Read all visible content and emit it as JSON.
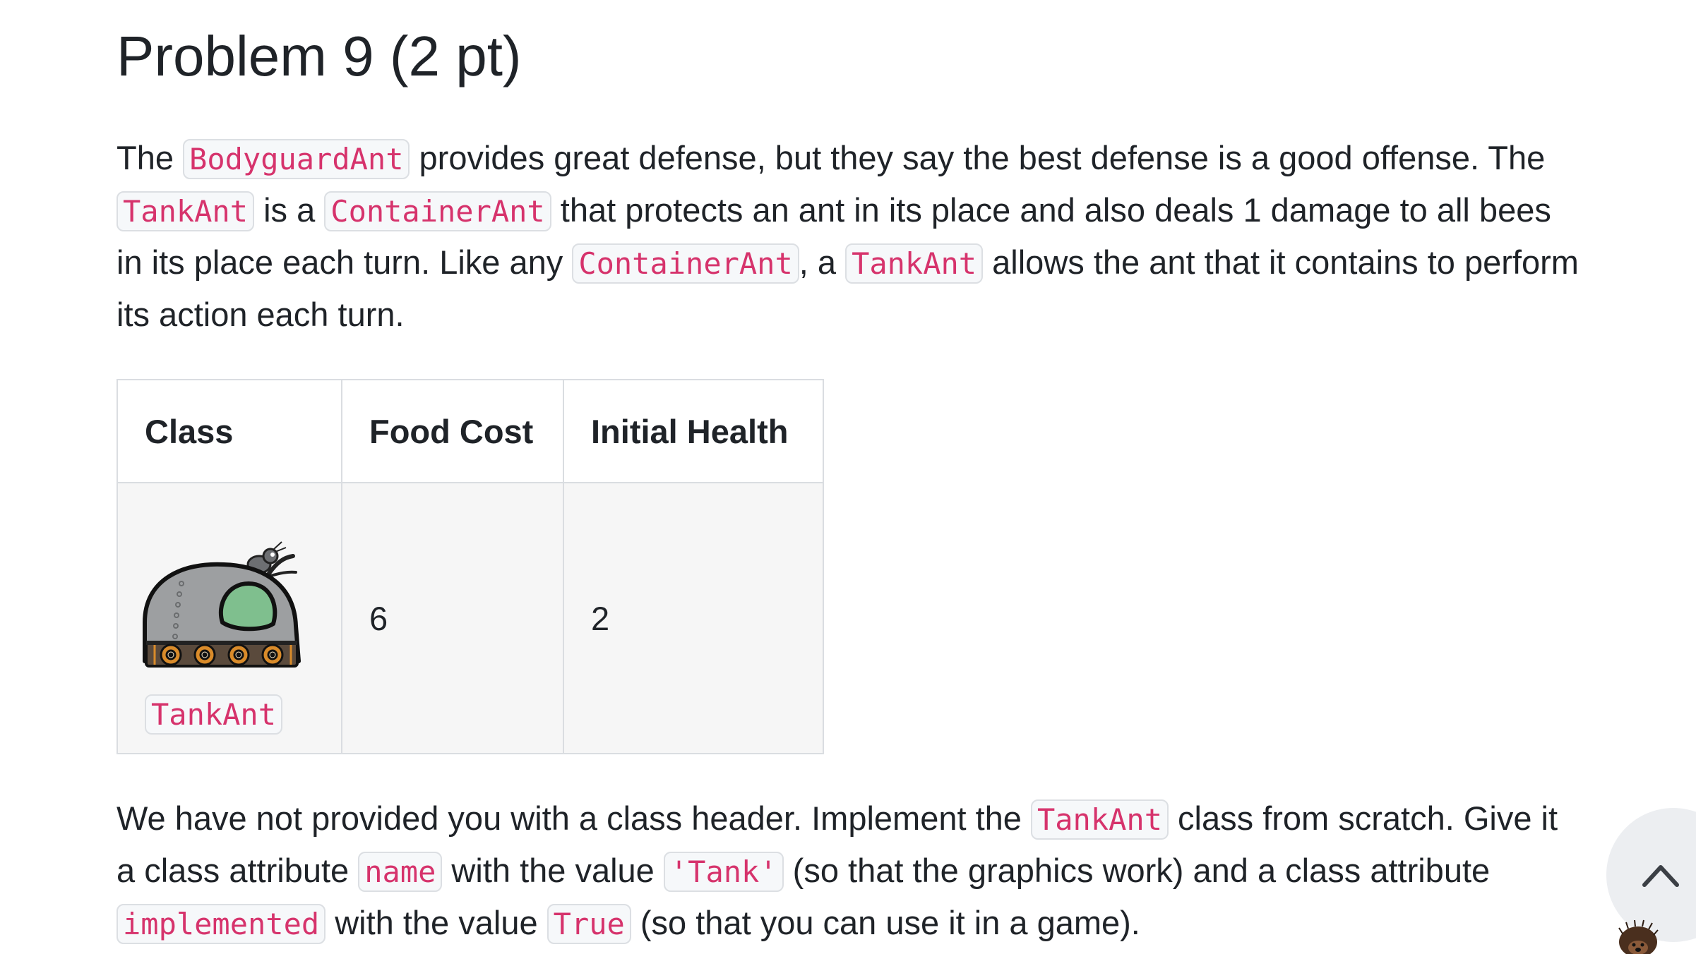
{
  "title": "Problem 9 (2 pt)",
  "paragraph1": {
    "t1": "The ",
    "c1": "BodyguardAnt",
    "t2": " provides great defense, but they say the best defense is a good offense. The ",
    "c2": "TankAnt",
    "t3": " is a ",
    "c3": "ContainerAnt",
    "t4": " that protects an ant in its place and also deals 1 damage to all bees in its place each turn. Like any ",
    "c4": "ContainerAnt",
    "t5": ", a ",
    "c5": "TankAnt",
    "t6": " allows the ant that it contains to perform its action each turn."
  },
  "table": {
    "headers": [
      "Class",
      "Food Cost",
      "Initial Health"
    ],
    "row": {
      "class_name": "TankAnt",
      "food_cost": "6",
      "initial_health": "2"
    }
  },
  "paragraph2": {
    "t1": "We have not provided you with a class header. Implement the ",
    "c1": "TankAnt",
    "t2": " class from scratch. Give it a class attribute ",
    "c2": "name",
    "t3": " with the value ",
    "c3": "'Tank'",
    "t4": " (so that the graphics work) and a class attribute ",
    "c4": "implemented",
    "t5": " with the value ",
    "c5": "True",
    "t6": " (so that you can use it in a game)."
  },
  "icons": {
    "scroll_top": "chevron-up-icon",
    "avatar": "hedgehog-avatar-icon",
    "tank": "tank-ant-image"
  },
  "colors": {
    "code_text": "#d6336c",
    "code_bg": "#f6f8fa",
    "tank_window": "#7fbf8e"
  }
}
